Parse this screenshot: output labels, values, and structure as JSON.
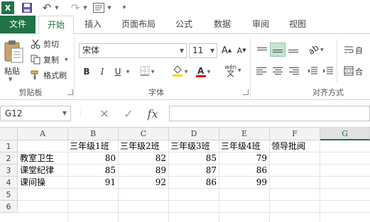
{
  "quick_access": {
    "app_logo": "X",
    "icons": [
      "excel-logo-icon",
      "save-icon",
      "undo-icon",
      "redo-icon",
      "form-icon",
      "customize-qat-icon"
    ]
  },
  "tabs": [
    "文件",
    "开始",
    "插入",
    "页面布局",
    "公式",
    "数据",
    "审阅",
    "视图"
  ],
  "ribbon": {
    "clipboard": {
      "paste": "粘贴",
      "cut": "剪切",
      "copy": "复制",
      "format_painter": "格式刷",
      "group_label": "剪贴板"
    },
    "font": {
      "name": "宋体",
      "size": "11",
      "grow": "A",
      "shrink": "A",
      "bold": "B",
      "italic": "I",
      "underline": "U",
      "font_color_letter": "A",
      "phonetic": "wén",
      "group_label": "字体"
    },
    "alignment": {
      "group_label": "对齐方式",
      "wrap_text": "自",
      "merge": "合"
    }
  },
  "formula_bar": {
    "name_box": "G12",
    "cancel": "✕",
    "enter": "✓",
    "fx": "fx",
    "formula": ""
  },
  "sheet": {
    "columns": [
      "A",
      "B",
      "C",
      "D",
      "E",
      "F",
      "G"
    ],
    "rows": [
      "1",
      "2",
      "3",
      "4",
      "5",
      "6"
    ],
    "cells": {
      "B1": "三年级1班",
      "C1": "三年级2班",
      "D1": "三年级3班",
      "E1": "三年级4班",
      "F1": "领导批阅",
      "A2": "教室卫生",
      "B2": "80",
      "C2": "82",
      "D2": "85",
      "E2": "79",
      "A3": "课堂纪律",
      "B3": "85",
      "C3": "89",
      "D3": "87",
      "E3": "86",
      "A4": "课间操",
      "B4": "91",
      "C4": "92",
      "D4": "86",
      "E4": "99"
    }
  },
  "colors": {
    "excel_green": "#217346",
    "font_color_red": "#e00000",
    "fill_yellow": "#ffd400"
  }
}
